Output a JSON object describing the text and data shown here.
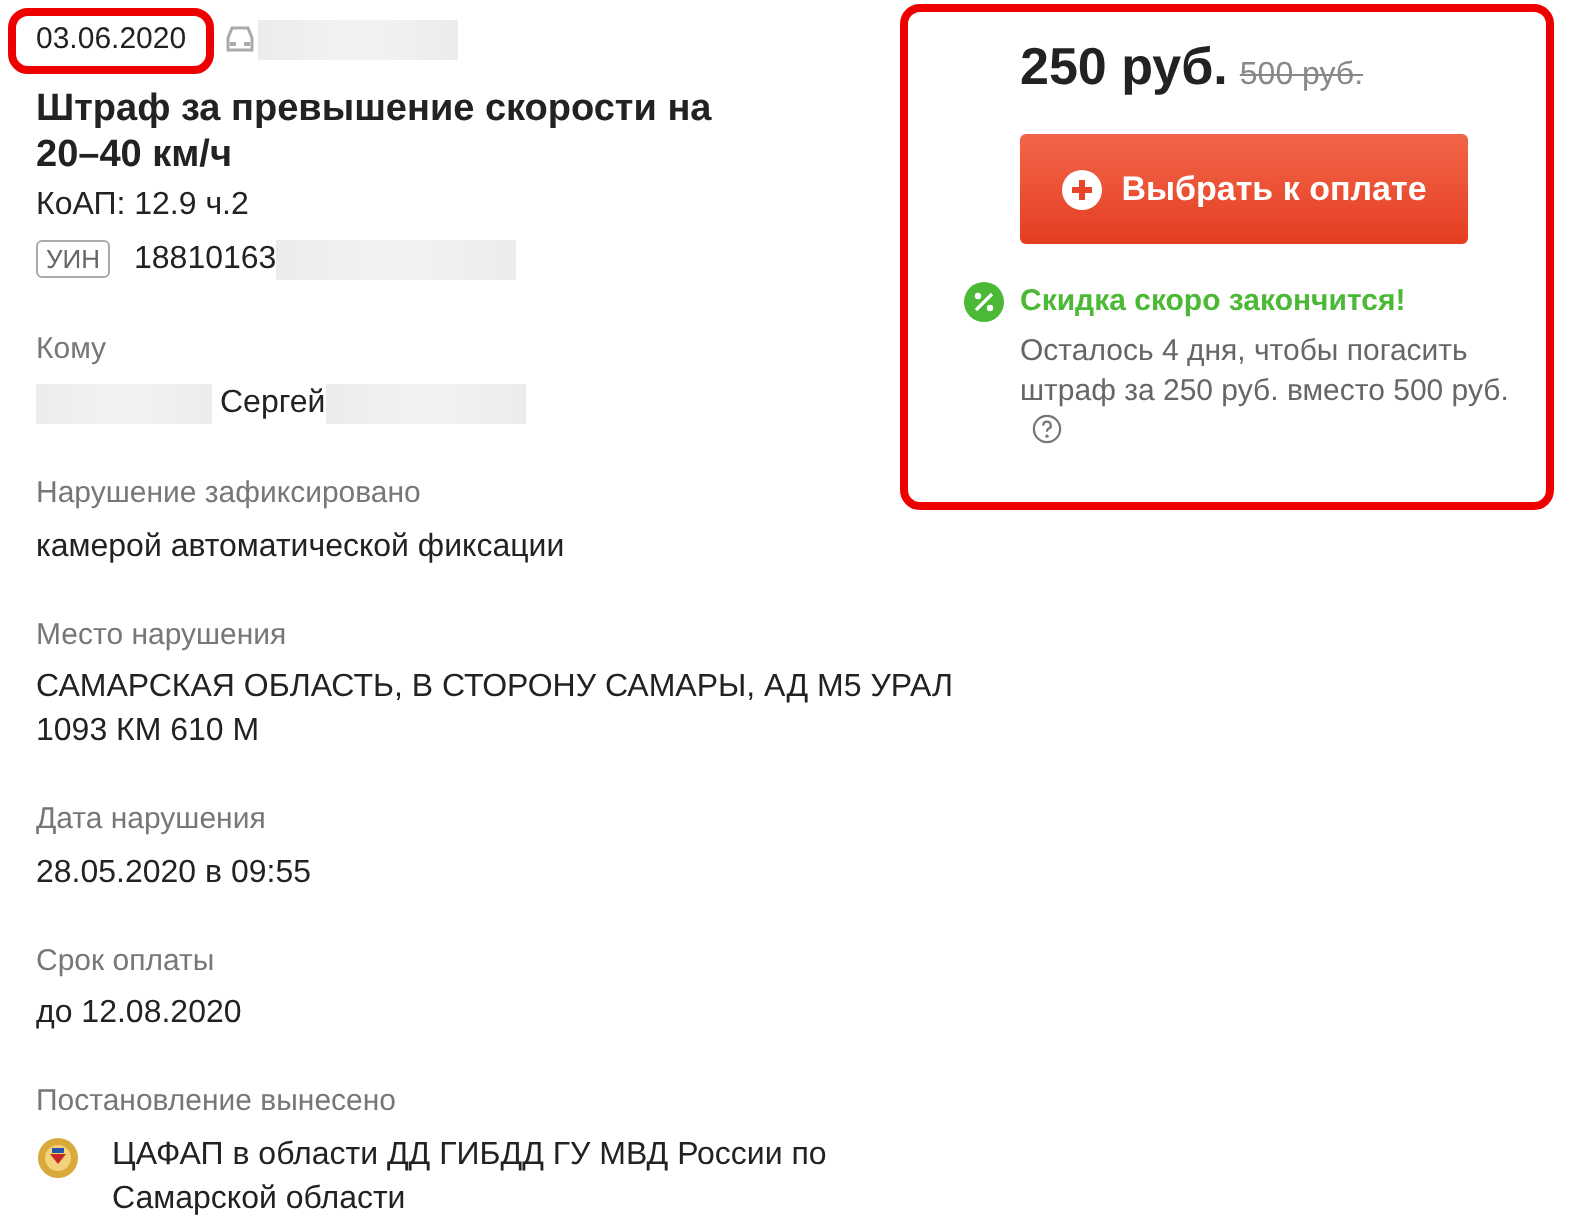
{
  "date": "03.06.2020",
  "title": "Штраф за превышение скорости на 20–40 км/ч",
  "article": "КоАП: 12.9 ч.2",
  "uin": {
    "tag": "УИН",
    "value": "18810163"
  },
  "details": [
    {
      "kind": "person",
      "label": "Кому",
      "value": "Сергей"
    },
    {
      "kind": "plain",
      "label": "Нарушение зафиксировано",
      "value": "камерой автоматической фиксации"
    },
    {
      "kind": "plain",
      "label": "Место нарушения",
      "value": "САМАРСКАЯ ОБЛАСТЬ, В СТОРОНУ САМАРЫ, АД М5 УРАЛ 1093 КМ 610 М"
    },
    {
      "kind": "plain",
      "label": "Дата нарушения",
      "value": "28.05.2020 в 09:55"
    },
    {
      "kind": "plain",
      "label": "Срок оплаты",
      "value": "до 12.08.2020"
    },
    {
      "kind": "issuer",
      "label": "Постановление вынесено",
      "value": "ЦАФАП в области ДД ГИБДД ГУ МВД России по Самарской области"
    }
  ],
  "payment": {
    "price": "250 руб.",
    "old_price": "500 руб.",
    "button": "Выбрать к оплате",
    "discount_title": "Скидка скоро закончится!",
    "discount_text": "Осталось 4 дня, чтобы погасить штраф за 250 руб. вместо 500 руб."
  }
}
